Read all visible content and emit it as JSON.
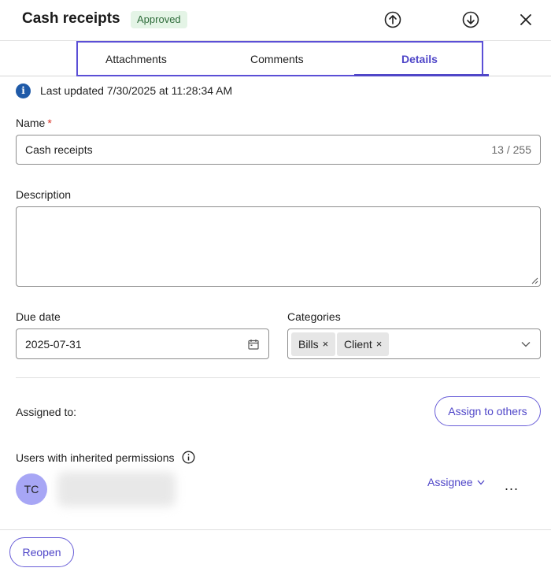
{
  "header": {
    "title": "Cash receipts",
    "status": "Approved",
    "upload_icon": "arrow-up-circle-icon",
    "download_icon": "arrow-down-circle-icon",
    "close_icon": "close-icon"
  },
  "tabs": [
    {
      "label": "Attachments",
      "active": false
    },
    {
      "label": "Comments",
      "active": false
    },
    {
      "label": "Details",
      "active": true
    }
  ],
  "info": {
    "icon": "info-icon",
    "text": "Last updated 7/30/2025 at 11:28:34 AM"
  },
  "form": {
    "name_label": "Name",
    "required_marker": "*",
    "name_value": "Cash receipts",
    "name_counter": "13 / 255",
    "description_label": "Description",
    "description_value": "",
    "due_date_label": "Due date",
    "due_date_value": "2025-07-31",
    "categories_label": "Categories",
    "categories": [
      "Bills",
      "Client"
    ],
    "chip_remove": "×"
  },
  "assignment": {
    "assigned_label": "Assigned to:",
    "assign_button": "Assign to others",
    "inherited_label": "Users with inherited permissions",
    "user_initials": "TC",
    "role": "Assignee",
    "more": "..."
  },
  "footer": {
    "reopen_button": "Reopen"
  },
  "colors": {
    "accent": "#4f46c8",
    "badge_bg": "#e4f4e6",
    "badge_text": "#2e6b3a",
    "avatar_bg": "#a7a6f5",
    "info_icon": "#1f5aa8"
  }
}
